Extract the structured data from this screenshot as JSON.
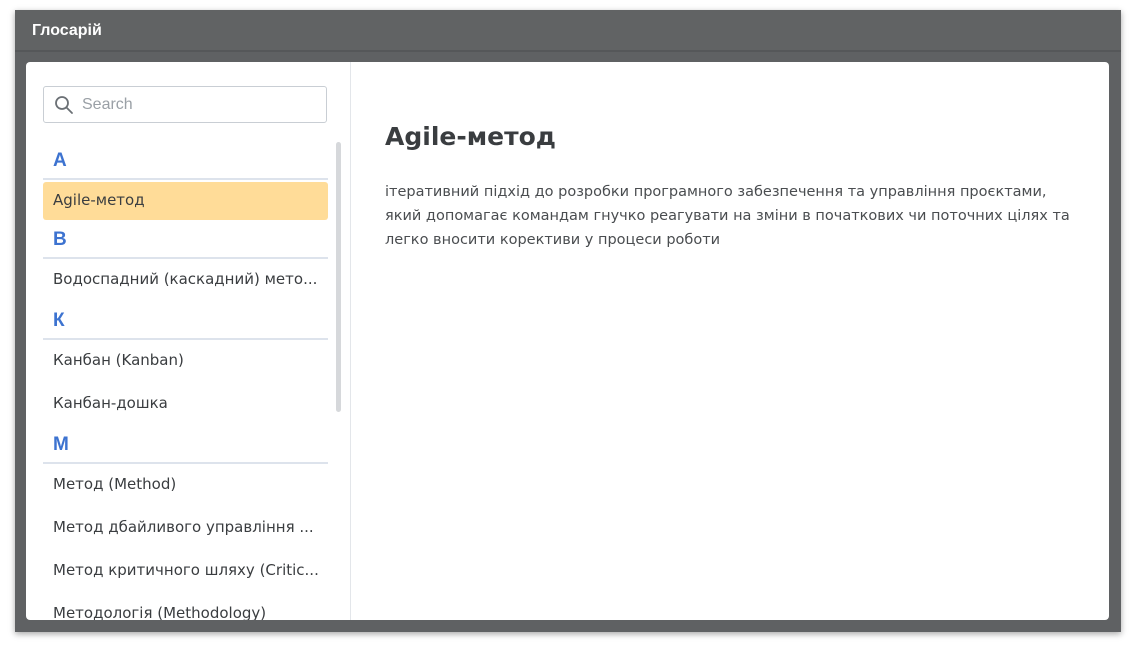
{
  "window": {
    "title": "Глосарій"
  },
  "search": {
    "placeholder": "Search",
    "value": ""
  },
  "glossary": {
    "groups": [
      {
        "letter": "A",
        "items": [
          "Agile-метод"
        ]
      },
      {
        "letter": "В",
        "items": [
          "Водоспадний (каскадний) мето..."
        ]
      },
      {
        "letter": "К",
        "items": [
          "Канбан (Kanban)",
          "Канбан-дошка"
        ]
      },
      {
        "letter": "М",
        "items": [
          "Метод (Method)",
          "Метод дбайливого управління ...",
          "Метод критичного шляху (Critic...",
          "Методологія (Methodology)"
        ]
      }
    ],
    "selected": "Agile-метод"
  },
  "detail": {
    "title": "Agile-метод",
    "definition": "ітеративний підхід до розробки програмного забезпечення та управління проєктами, який допомагає командам гнучко реагувати на зміни в початкових чи поточних цілях та легко вносити корективи у процеси роботи"
  },
  "colors": {
    "titlebar": "#616364",
    "letter": "#3d73d0",
    "selected": "#ffdc98"
  }
}
